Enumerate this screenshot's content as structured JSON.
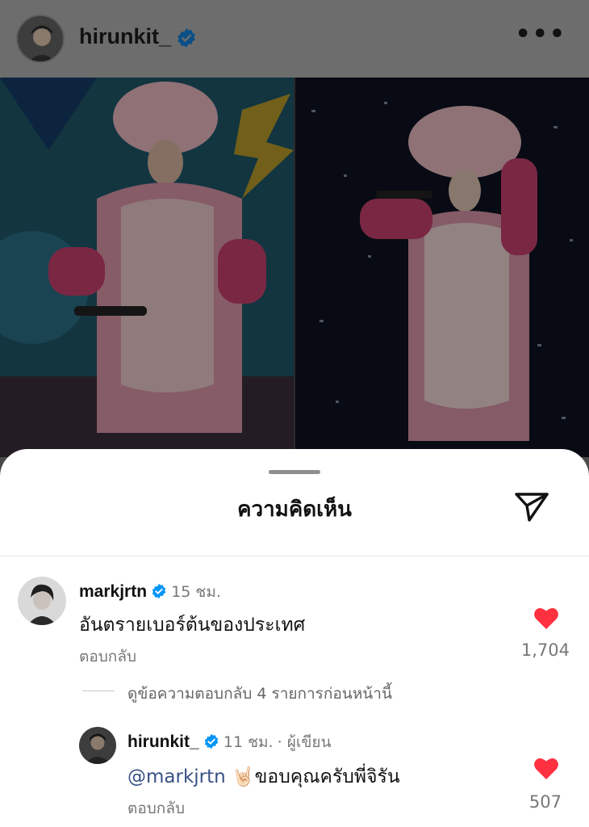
{
  "post": {
    "username": "hirunkit_",
    "verified": true,
    "more_icon": "more-horizontal-icon"
  },
  "sheet": {
    "title": "ความคิดเห็น",
    "share_icon": "send-icon"
  },
  "comments": [
    {
      "username": "markjrtn",
      "verified": true,
      "time": "15 ชม.",
      "text": "อันตรายเบอร์ต้นของประเทศ",
      "reply_label": "ตอบกลับ",
      "likes": "1,704",
      "liked": true,
      "view_replies": "ดูข้อความตอบกลับ 4 รายการก่อนหน้านี้"
    },
    {
      "username": "hirunkit_",
      "verified": true,
      "time": "11 ชม.",
      "author_tag": "· ผู้เขียน",
      "mention": "@markjrtn",
      "emoji": "🤘🏻",
      "text": "ขอบคุณครับพี่จิรัน",
      "reply_label": "ตอบกลับ",
      "likes": "507",
      "liked": true
    }
  ],
  "colors": {
    "heart": "#ff3040",
    "verified": "#0095f6",
    "mention": "#385185"
  }
}
